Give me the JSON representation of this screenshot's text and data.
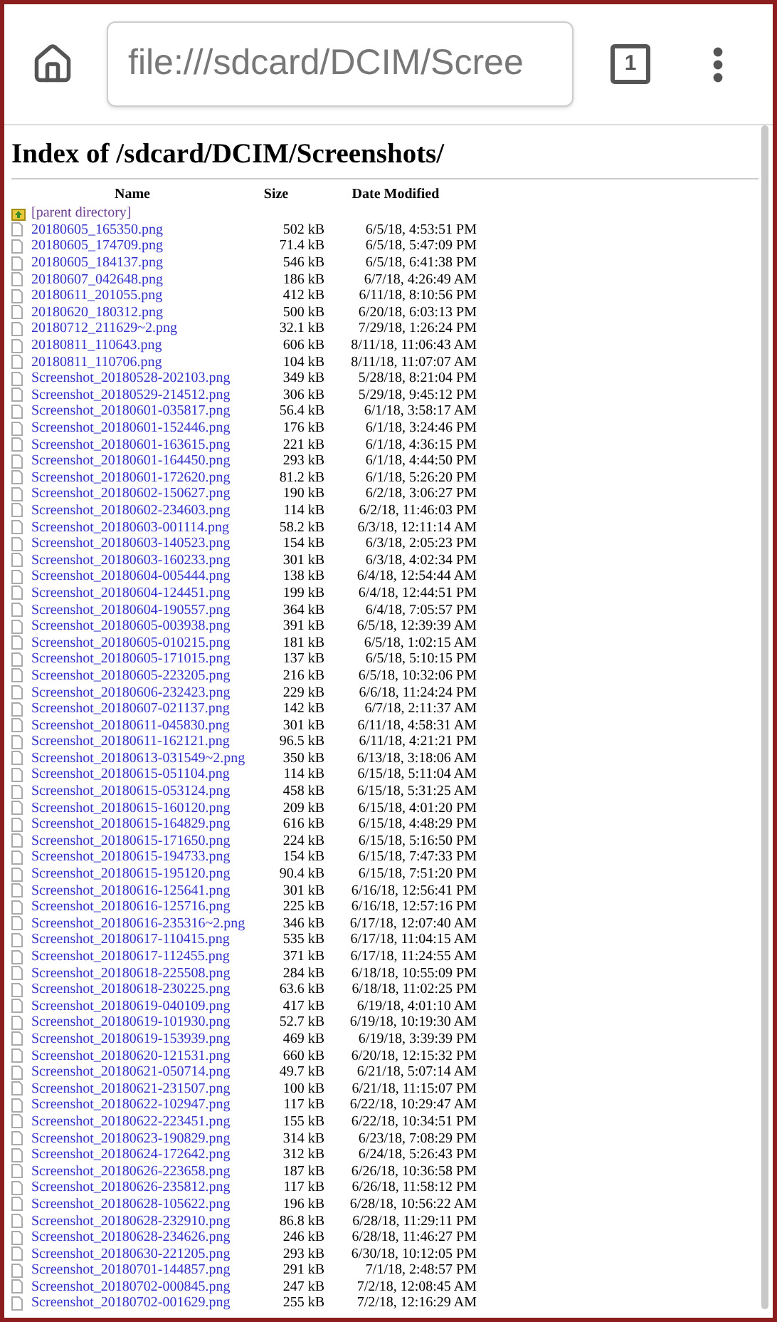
{
  "address_bar": {
    "text": "file:///sdcard/DCIM/Scree"
  },
  "tab_count": "1",
  "heading": "Index of /sdcard/DCIM/Screenshots/",
  "columns": [
    "Name",
    "Size",
    "Date Modified"
  ],
  "parent_link": "[parent directory]",
  "files": [
    {
      "name": "20180605_165350.png",
      "size": "502 kB",
      "date": "6/5/18, 4:53:51 PM"
    },
    {
      "name": "20180605_174709.png",
      "size": "71.4 kB",
      "date": "6/5/18, 5:47:09 PM"
    },
    {
      "name": "20180605_184137.png",
      "size": "546 kB",
      "date": "6/5/18, 6:41:38 PM"
    },
    {
      "name": "20180607_042648.png",
      "size": "186 kB",
      "date": "6/7/18, 4:26:49 AM"
    },
    {
      "name": "20180611_201055.png",
      "size": "412 kB",
      "date": "6/11/18, 8:10:56 PM"
    },
    {
      "name": "20180620_180312.png",
      "size": "500 kB",
      "date": "6/20/18, 6:03:13 PM"
    },
    {
      "name": "20180712_211629~2.png",
      "size": "32.1 kB",
      "date": "7/29/18, 1:26:24 PM"
    },
    {
      "name": "20180811_110643.png",
      "size": "606 kB",
      "date": "8/11/18, 11:06:43 AM"
    },
    {
      "name": "20180811_110706.png",
      "size": "104 kB",
      "date": "8/11/18, 11:07:07 AM"
    },
    {
      "name": "Screenshot_20180528-202103.png",
      "size": "349 kB",
      "date": "5/28/18, 8:21:04 PM"
    },
    {
      "name": "Screenshot_20180529-214512.png",
      "size": "306 kB",
      "date": "5/29/18, 9:45:12 PM"
    },
    {
      "name": "Screenshot_20180601-035817.png",
      "size": "56.4 kB",
      "date": "6/1/18, 3:58:17 AM"
    },
    {
      "name": "Screenshot_20180601-152446.png",
      "size": "176 kB",
      "date": "6/1/18, 3:24:46 PM"
    },
    {
      "name": "Screenshot_20180601-163615.png",
      "size": "221 kB",
      "date": "6/1/18, 4:36:15 PM"
    },
    {
      "name": "Screenshot_20180601-164450.png",
      "size": "293 kB",
      "date": "6/1/18, 4:44:50 PM"
    },
    {
      "name": "Screenshot_20180601-172620.png",
      "size": "81.2 kB",
      "date": "6/1/18, 5:26:20 PM"
    },
    {
      "name": "Screenshot_20180602-150627.png",
      "size": "190 kB",
      "date": "6/2/18, 3:06:27 PM"
    },
    {
      "name": "Screenshot_20180602-234603.png",
      "size": "114 kB",
      "date": "6/2/18, 11:46:03 PM"
    },
    {
      "name": "Screenshot_20180603-001114.png",
      "size": "58.2 kB",
      "date": "6/3/18, 12:11:14 AM"
    },
    {
      "name": "Screenshot_20180603-140523.png",
      "size": "154 kB",
      "date": "6/3/18, 2:05:23 PM"
    },
    {
      "name": "Screenshot_20180603-160233.png",
      "size": "301 kB",
      "date": "6/3/18, 4:02:34 PM"
    },
    {
      "name": "Screenshot_20180604-005444.png",
      "size": "138 kB",
      "date": "6/4/18, 12:54:44 AM"
    },
    {
      "name": "Screenshot_20180604-124451.png",
      "size": "199 kB",
      "date": "6/4/18, 12:44:51 PM"
    },
    {
      "name": "Screenshot_20180604-190557.png",
      "size": "364 kB",
      "date": "6/4/18, 7:05:57 PM"
    },
    {
      "name": "Screenshot_20180605-003938.png",
      "size": "391 kB",
      "date": "6/5/18, 12:39:39 AM"
    },
    {
      "name": "Screenshot_20180605-010215.png",
      "size": "181 kB",
      "date": "6/5/18, 1:02:15 AM"
    },
    {
      "name": "Screenshot_20180605-171015.png",
      "size": "137 kB",
      "date": "6/5/18, 5:10:15 PM"
    },
    {
      "name": "Screenshot_20180605-223205.png",
      "size": "216 kB",
      "date": "6/5/18, 10:32:06 PM"
    },
    {
      "name": "Screenshot_20180606-232423.png",
      "size": "229 kB",
      "date": "6/6/18, 11:24:24 PM"
    },
    {
      "name": "Screenshot_20180607-021137.png",
      "size": "142 kB",
      "date": "6/7/18, 2:11:37 AM"
    },
    {
      "name": "Screenshot_20180611-045830.png",
      "size": "301 kB",
      "date": "6/11/18, 4:58:31 AM"
    },
    {
      "name": "Screenshot_20180611-162121.png",
      "size": "96.5 kB",
      "date": "6/11/18, 4:21:21 PM"
    },
    {
      "name": "Screenshot_20180613-031549~2.png",
      "size": "350 kB",
      "date": "6/13/18, 3:18:06 AM"
    },
    {
      "name": "Screenshot_20180615-051104.png",
      "size": "114 kB",
      "date": "6/15/18, 5:11:04 AM"
    },
    {
      "name": "Screenshot_20180615-053124.png",
      "size": "458 kB",
      "date": "6/15/18, 5:31:25 AM"
    },
    {
      "name": "Screenshot_20180615-160120.png",
      "size": "209 kB",
      "date": "6/15/18, 4:01:20 PM"
    },
    {
      "name": "Screenshot_20180615-164829.png",
      "size": "616 kB",
      "date": "6/15/18, 4:48:29 PM"
    },
    {
      "name": "Screenshot_20180615-171650.png",
      "size": "224 kB",
      "date": "6/15/18, 5:16:50 PM"
    },
    {
      "name": "Screenshot_20180615-194733.png",
      "size": "154 kB",
      "date": "6/15/18, 7:47:33 PM"
    },
    {
      "name": "Screenshot_20180615-195120.png",
      "size": "90.4 kB",
      "date": "6/15/18, 7:51:20 PM"
    },
    {
      "name": "Screenshot_20180616-125641.png",
      "size": "301 kB",
      "date": "6/16/18, 12:56:41 PM"
    },
    {
      "name": "Screenshot_20180616-125716.png",
      "size": "225 kB",
      "date": "6/16/18, 12:57:16 PM"
    },
    {
      "name": "Screenshot_20180616-235316~2.png",
      "size": "346 kB",
      "date": "6/17/18, 12:07:40 AM"
    },
    {
      "name": "Screenshot_20180617-110415.png",
      "size": "535 kB",
      "date": "6/17/18, 11:04:15 AM"
    },
    {
      "name": "Screenshot_20180617-112455.png",
      "size": "371 kB",
      "date": "6/17/18, 11:24:55 AM"
    },
    {
      "name": "Screenshot_20180618-225508.png",
      "size": "284 kB",
      "date": "6/18/18, 10:55:09 PM"
    },
    {
      "name": "Screenshot_20180618-230225.png",
      "size": "63.6 kB",
      "date": "6/18/18, 11:02:25 PM"
    },
    {
      "name": "Screenshot_20180619-040109.png",
      "size": "417 kB",
      "date": "6/19/18, 4:01:10 AM"
    },
    {
      "name": "Screenshot_20180619-101930.png",
      "size": "52.7 kB",
      "date": "6/19/18, 10:19:30 AM"
    },
    {
      "name": "Screenshot_20180619-153939.png",
      "size": "469 kB",
      "date": "6/19/18, 3:39:39 PM"
    },
    {
      "name": "Screenshot_20180620-121531.png",
      "size": "660 kB",
      "date": "6/20/18, 12:15:32 PM"
    },
    {
      "name": "Screenshot_20180621-050714.png",
      "size": "49.7 kB",
      "date": "6/21/18, 5:07:14 AM"
    },
    {
      "name": "Screenshot_20180621-231507.png",
      "size": "100 kB",
      "date": "6/21/18, 11:15:07 PM"
    },
    {
      "name": "Screenshot_20180622-102947.png",
      "size": "117 kB",
      "date": "6/22/18, 10:29:47 AM"
    },
    {
      "name": "Screenshot_20180622-223451.png",
      "size": "155 kB",
      "date": "6/22/18, 10:34:51 PM"
    },
    {
      "name": "Screenshot_20180623-190829.png",
      "size": "314 kB",
      "date": "6/23/18, 7:08:29 PM"
    },
    {
      "name": "Screenshot_20180624-172642.png",
      "size": "312 kB",
      "date": "6/24/18, 5:26:43 PM"
    },
    {
      "name": "Screenshot_20180626-223658.png",
      "size": "187 kB",
      "date": "6/26/18, 10:36:58 PM"
    },
    {
      "name": "Screenshot_20180626-235812.png",
      "size": "117 kB",
      "date": "6/26/18, 11:58:12 PM"
    },
    {
      "name": "Screenshot_20180628-105622.png",
      "size": "196 kB",
      "date": "6/28/18, 10:56:22 AM"
    },
    {
      "name": "Screenshot_20180628-232910.png",
      "size": "86.8 kB",
      "date": "6/28/18, 11:29:11 PM"
    },
    {
      "name": "Screenshot_20180628-234626.png",
      "size": "246 kB",
      "date": "6/28/18, 11:46:27 PM"
    },
    {
      "name": "Screenshot_20180630-221205.png",
      "size": "293 kB",
      "date": "6/30/18, 10:12:05 PM"
    },
    {
      "name": "Screenshot_20180701-144857.png",
      "size": "291 kB",
      "date": "7/1/18, 2:48:57 PM"
    },
    {
      "name": "Screenshot_20180702-000845.png",
      "size": "247 kB",
      "date": "7/2/18, 12:08:45 AM"
    },
    {
      "name": "Screenshot_20180702-001629.png",
      "size": "255 kB",
      "date": "7/2/18, 12:16:29 AM"
    }
  ]
}
